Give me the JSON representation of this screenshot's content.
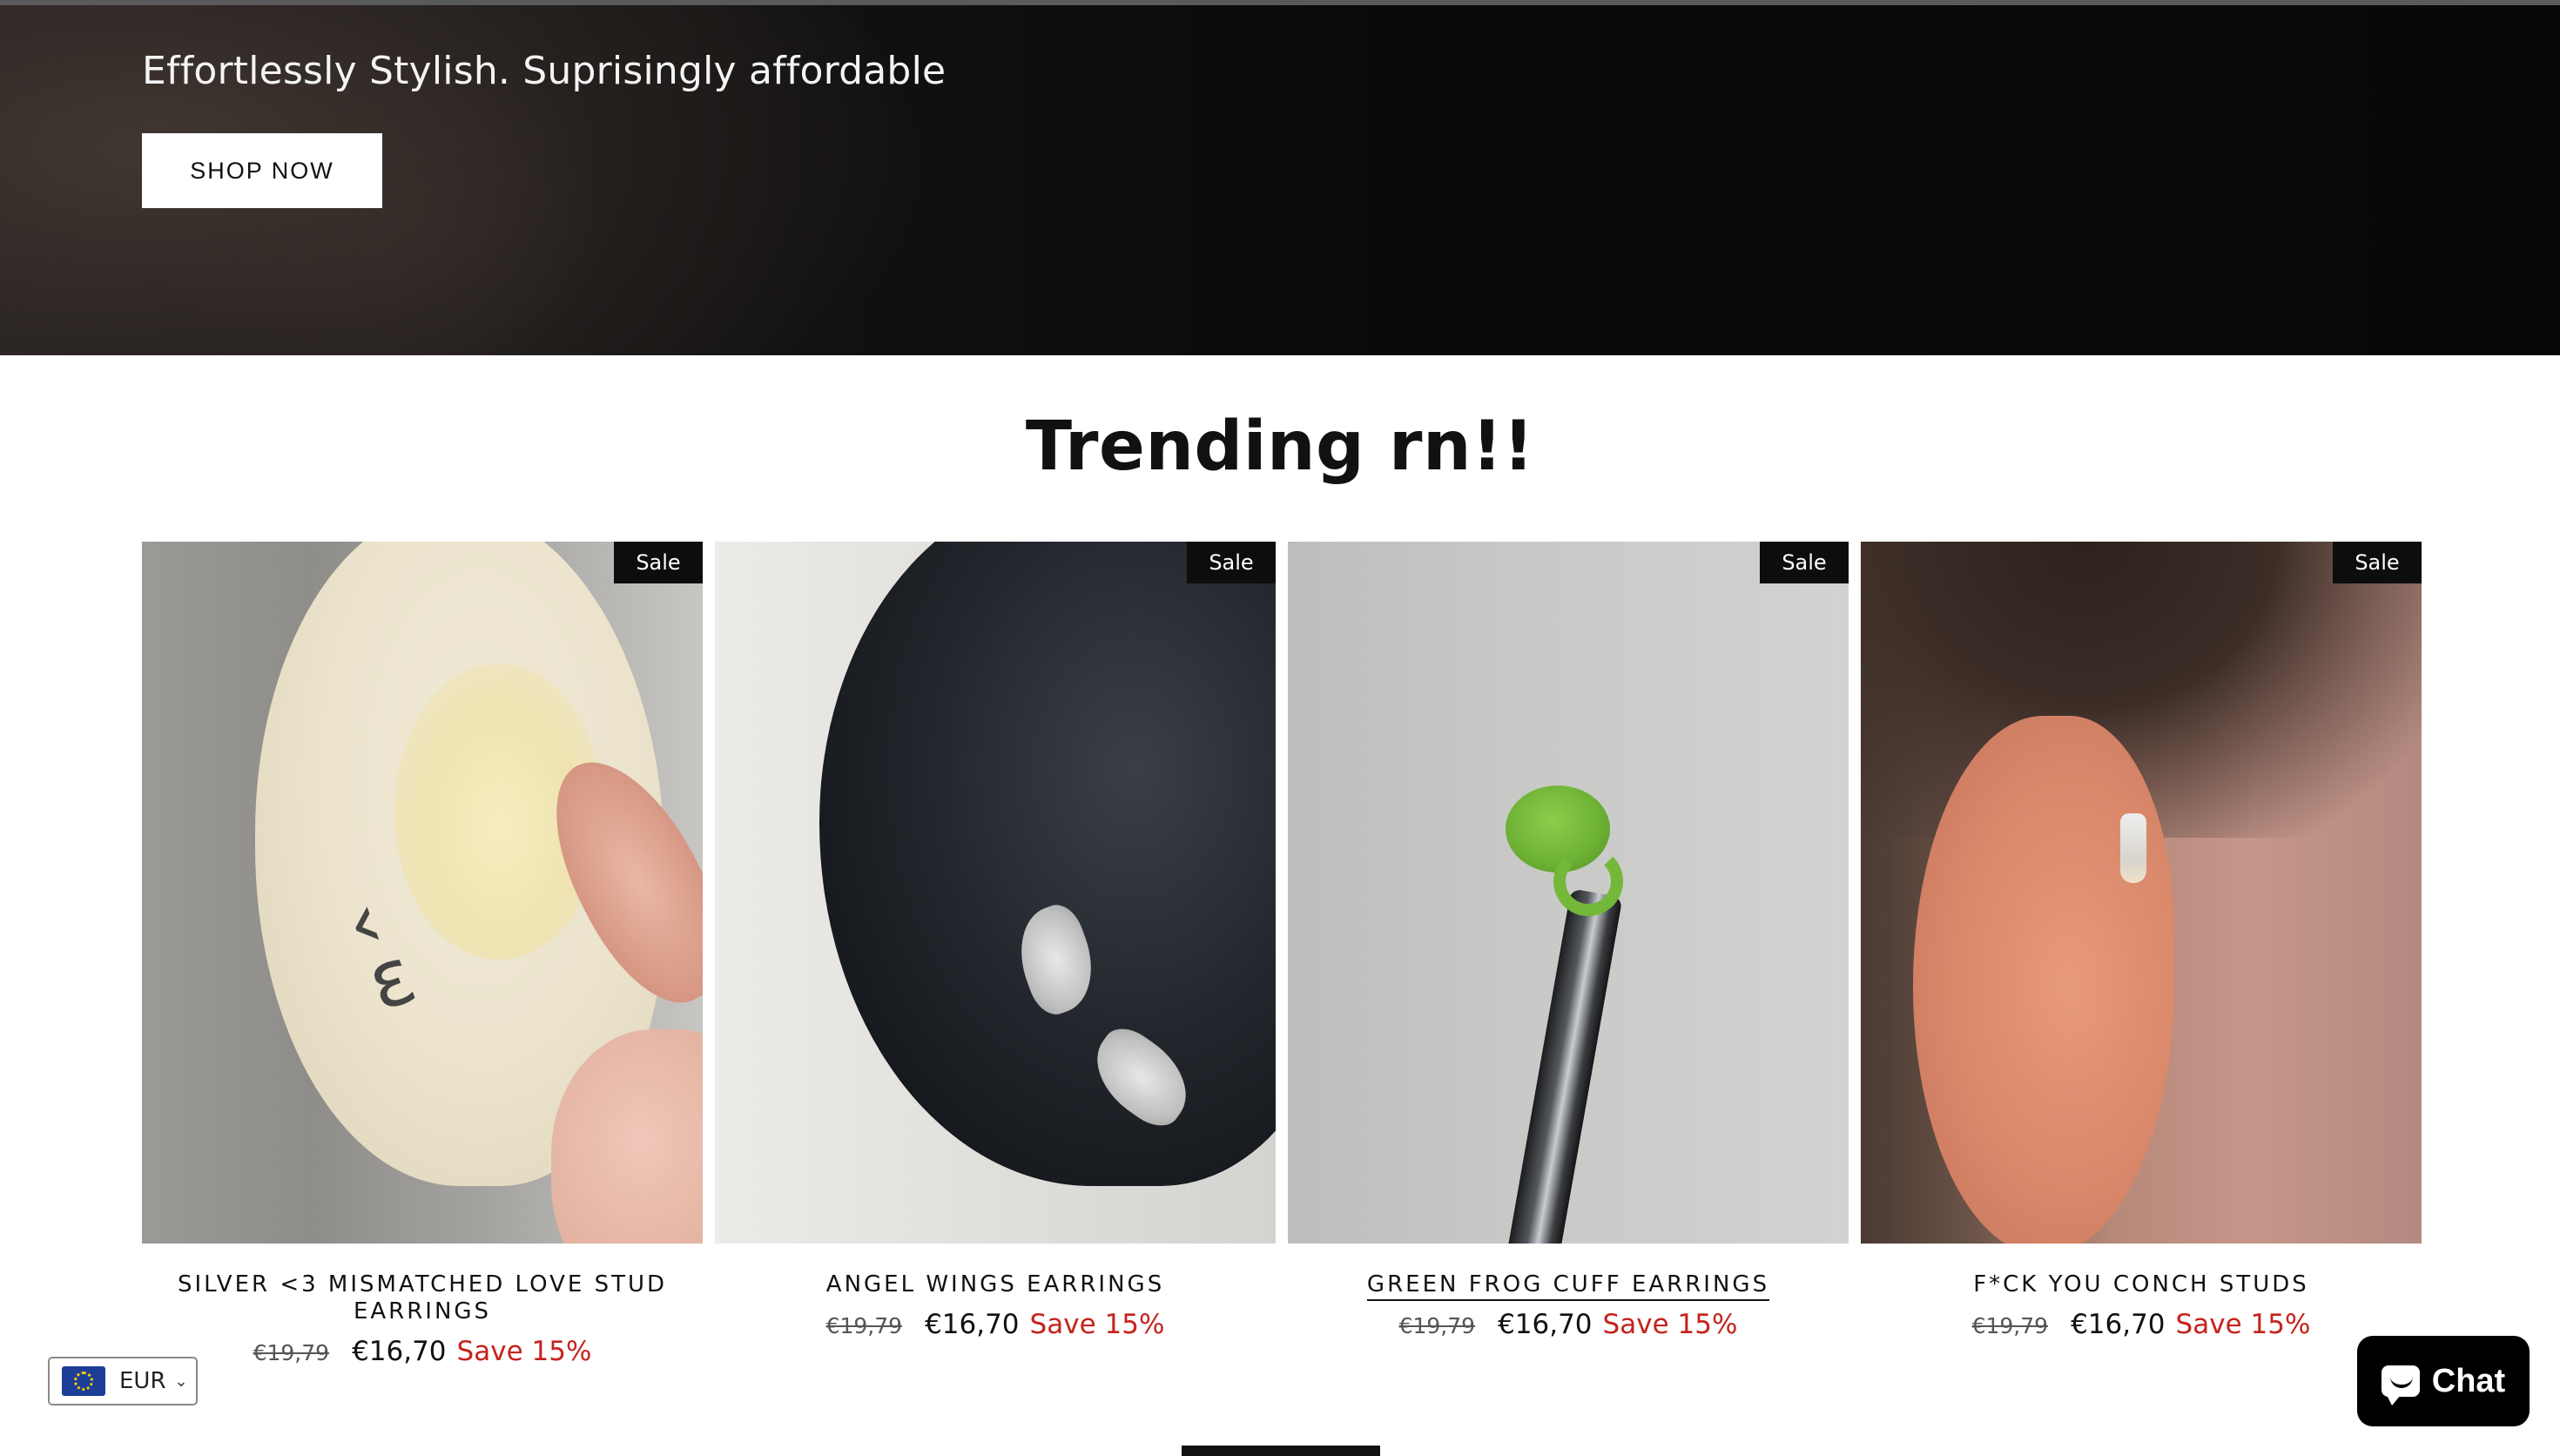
{
  "hero": {
    "tagline": "Effortlessly Stylish. Suprisingly affordable",
    "cta_label": "SHOP NOW"
  },
  "section": {
    "title": "Trending rn!!"
  },
  "products": [
    {
      "title": "SILVER <3 MISMATCHED LOVE STUD EARRINGS",
      "badge": "Sale",
      "old_price": "€19,79",
      "new_price": "€16,70",
      "save": "Save 15%"
    },
    {
      "title": "ANGEL WINGS EARRINGS",
      "badge": "Sale",
      "old_price": "€19,79",
      "new_price": "€16,70",
      "save": "Save 15%"
    },
    {
      "title": "GREEN FROG CUFF EARRINGS",
      "badge": "Sale",
      "old_price": "€19,79",
      "new_price": "€16,70",
      "save": "Save 15%"
    },
    {
      "title": "F*CK YOU CONCH STUDS",
      "badge": "Sale",
      "old_price": "€19,79",
      "new_price": "€16,70",
      "save": "Save 15%"
    }
  ],
  "currency": {
    "code": "EUR",
    "icon": "eu-flag-icon"
  },
  "chat": {
    "label": "Chat",
    "icon": "chat-bubble-icon"
  },
  "colors": {
    "sale_red": "#c4231c",
    "badge_bg": "#0d0d0d",
    "chat_bg": "#000000"
  }
}
